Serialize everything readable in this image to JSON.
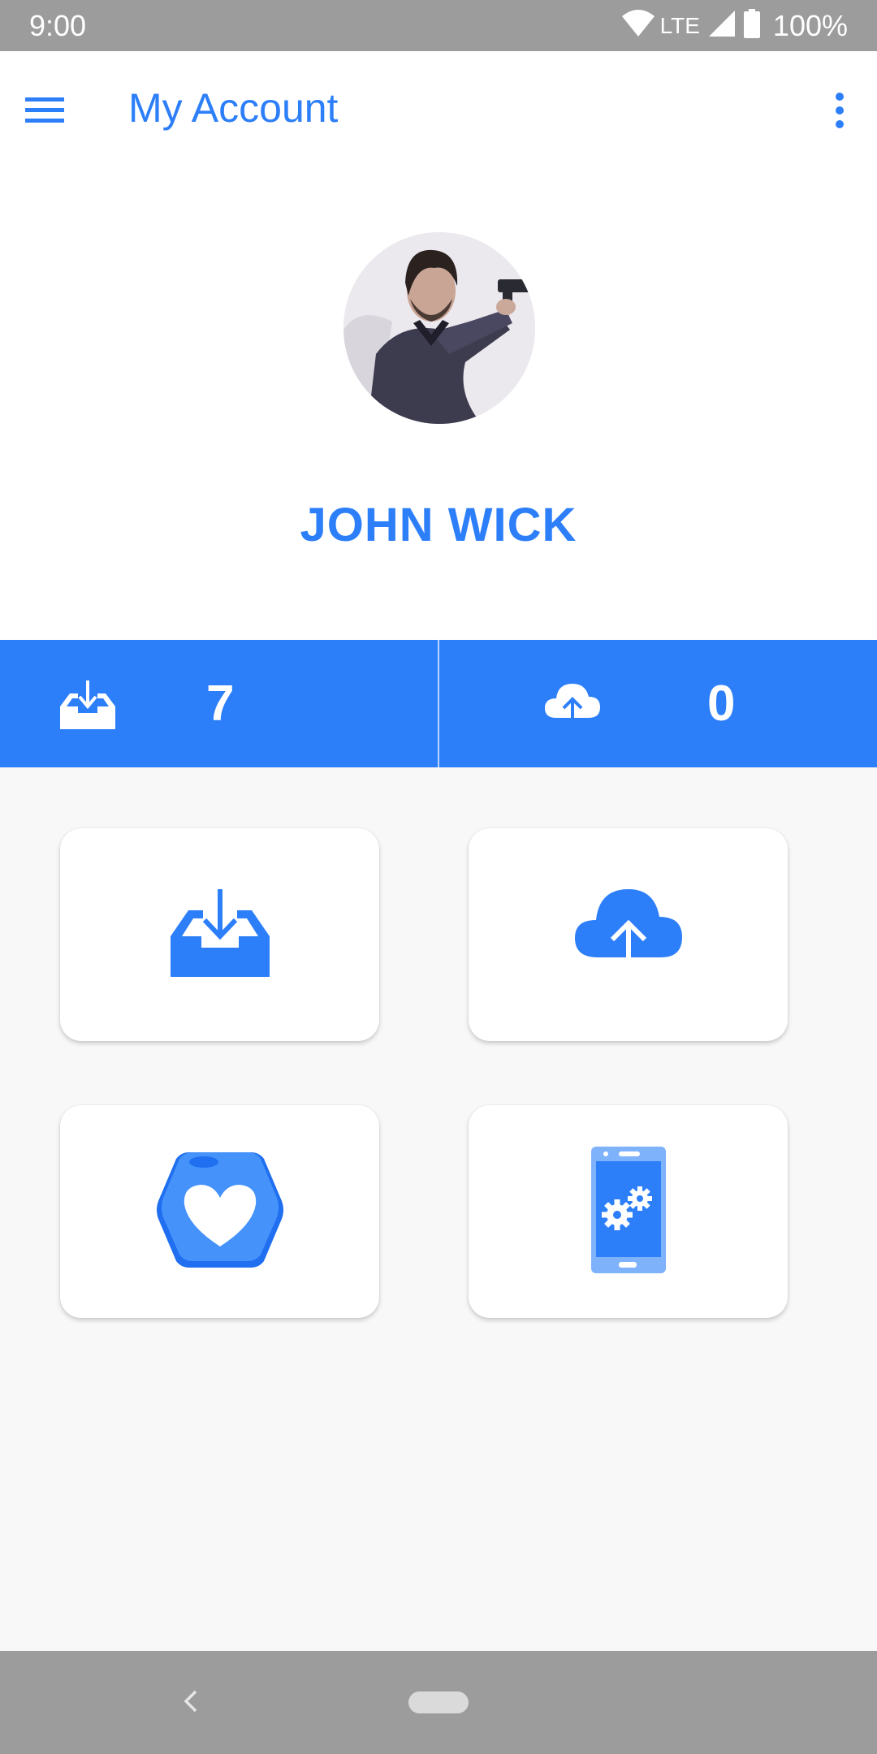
{
  "status_bar": {
    "time": "9:00",
    "network": "LTE",
    "battery": "100%",
    "icons": [
      "wifi-icon",
      "cell-signal-icon",
      "battery-icon"
    ]
  },
  "app_bar": {
    "title": "My Account",
    "menu_icon": "hamburger-menu-icon",
    "more_icon": "more-vertical-icon"
  },
  "profile": {
    "name": "JOHN WICK",
    "avatar": "profile-photo"
  },
  "stats": [
    {
      "icon": "inbox-download-icon",
      "value": "7"
    },
    {
      "icon": "cloud-upload-icon",
      "value": "0"
    }
  ],
  "tiles": [
    {
      "icon": "inbox-download-icon"
    },
    {
      "icon": "cloud-upload-icon"
    },
    {
      "icon": "heart-hexagon-icon"
    },
    {
      "icon": "phone-settings-icon"
    }
  ],
  "colors": {
    "accent": "#2d7ff9",
    "system_bars": "#9c9c9c",
    "background": "#f8f8f8"
  },
  "nav_bar": {
    "icons": [
      "back-icon",
      "home-pill-icon"
    ]
  }
}
